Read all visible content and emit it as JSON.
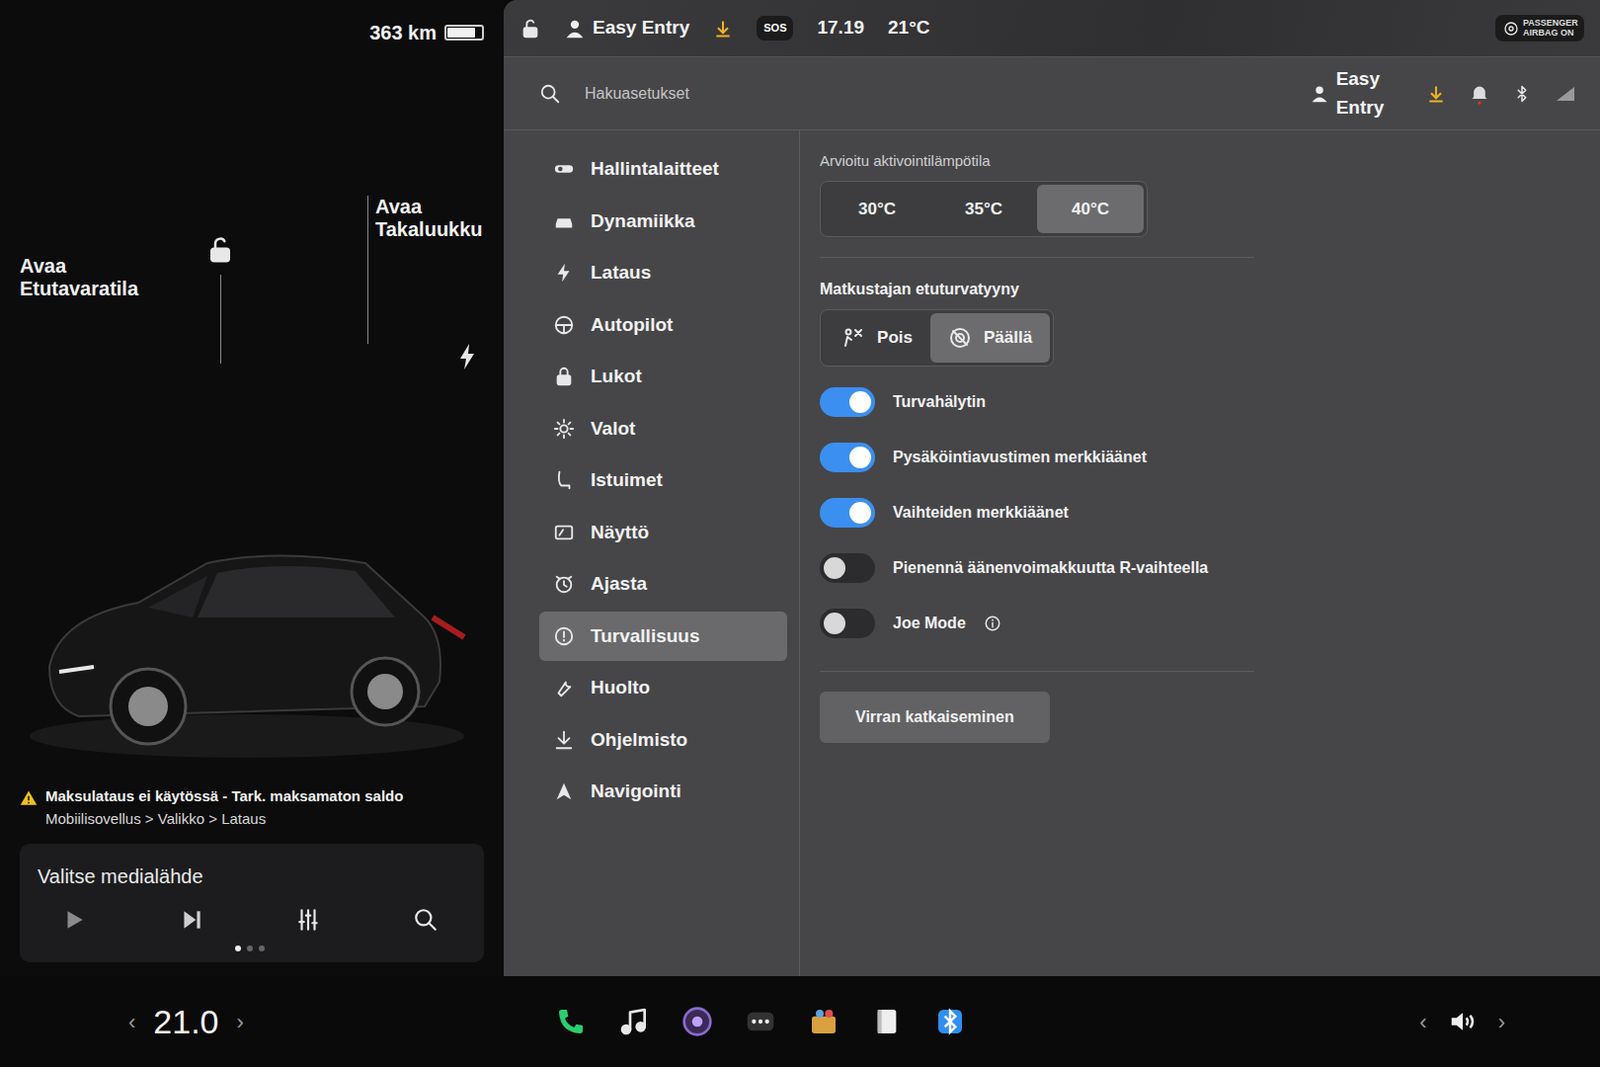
{
  "status": {
    "range": "363 km",
    "battery_level": 0.82
  },
  "car": {
    "frunk_label": "Avaa Etutavaratila",
    "trunk_label": "Avaa Takaluukku",
    "locked": false
  },
  "alert": {
    "title": "Maksulataus ei käytössä - Tark. maksamaton saldo",
    "path": "Mobiilisovellus > Valikko > Lataus"
  },
  "media": {
    "source": "Valitse medialähde"
  },
  "topbar": {
    "profile": "Easy Entry",
    "sos": "SOS",
    "time": "17.19",
    "temp": "21°C",
    "airbag_badge": "PASSENGER AIRBAG ON"
  },
  "search": {
    "placeholder": "Hakuasetukset"
  },
  "header": {
    "profile": "Easy Entry"
  },
  "sidebar": {
    "items": [
      {
        "label": "Hallintalaitteet",
        "selected": false
      },
      {
        "label": "Dynamiikka",
        "selected": false
      },
      {
        "label": "Lataus",
        "selected": false
      },
      {
        "label": "Autopilot",
        "selected": false
      },
      {
        "label": "Lukot",
        "selected": false
      },
      {
        "label": "Valot",
        "selected": false
      },
      {
        "label": "Istuimet",
        "selected": false
      },
      {
        "label": "Näyttö",
        "selected": false
      },
      {
        "label": "Ajasta",
        "selected": false
      },
      {
        "label": "Turvallisuus",
        "selected": true
      },
      {
        "label": "Huolto",
        "selected": false
      },
      {
        "label": "Ohjelmisto",
        "selected": false
      },
      {
        "label": "Navigointi",
        "selected": false
      }
    ]
  },
  "activation": {
    "title": "Arvioitu aktivointilämpötila",
    "options": [
      {
        "label": "30°C",
        "selected": false
      },
      {
        "label": "35°C",
        "selected": false
      },
      {
        "label": "40°C",
        "selected": true
      }
    ]
  },
  "airbag": {
    "title": "Matkustajan etuturvatyyny",
    "options": [
      {
        "label": "Pois",
        "selected": false
      },
      {
        "label": "Päällä",
        "selected": true
      }
    ]
  },
  "toggles": [
    {
      "label": "Turvahälytin",
      "on": true
    },
    {
      "label": "Pysäköintiavustimen merkkiäänet",
      "on": true
    },
    {
      "label": "Vaihteiden merkkiäänet",
      "on": true
    },
    {
      "label": "Pienennä äänenvoimakkuutta R-vaihteella",
      "on": false
    },
    {
      "label": "Joe Mode",
      "on": false
    }
  ],
  "power_button": "Virran katkaiseminen",
  "climate": {
    "temp": "21.0",
    "down": "‹",
    "up": "›"
  },
  "volume": {
    "down": "‹",
    "up": "›"
  }
}
